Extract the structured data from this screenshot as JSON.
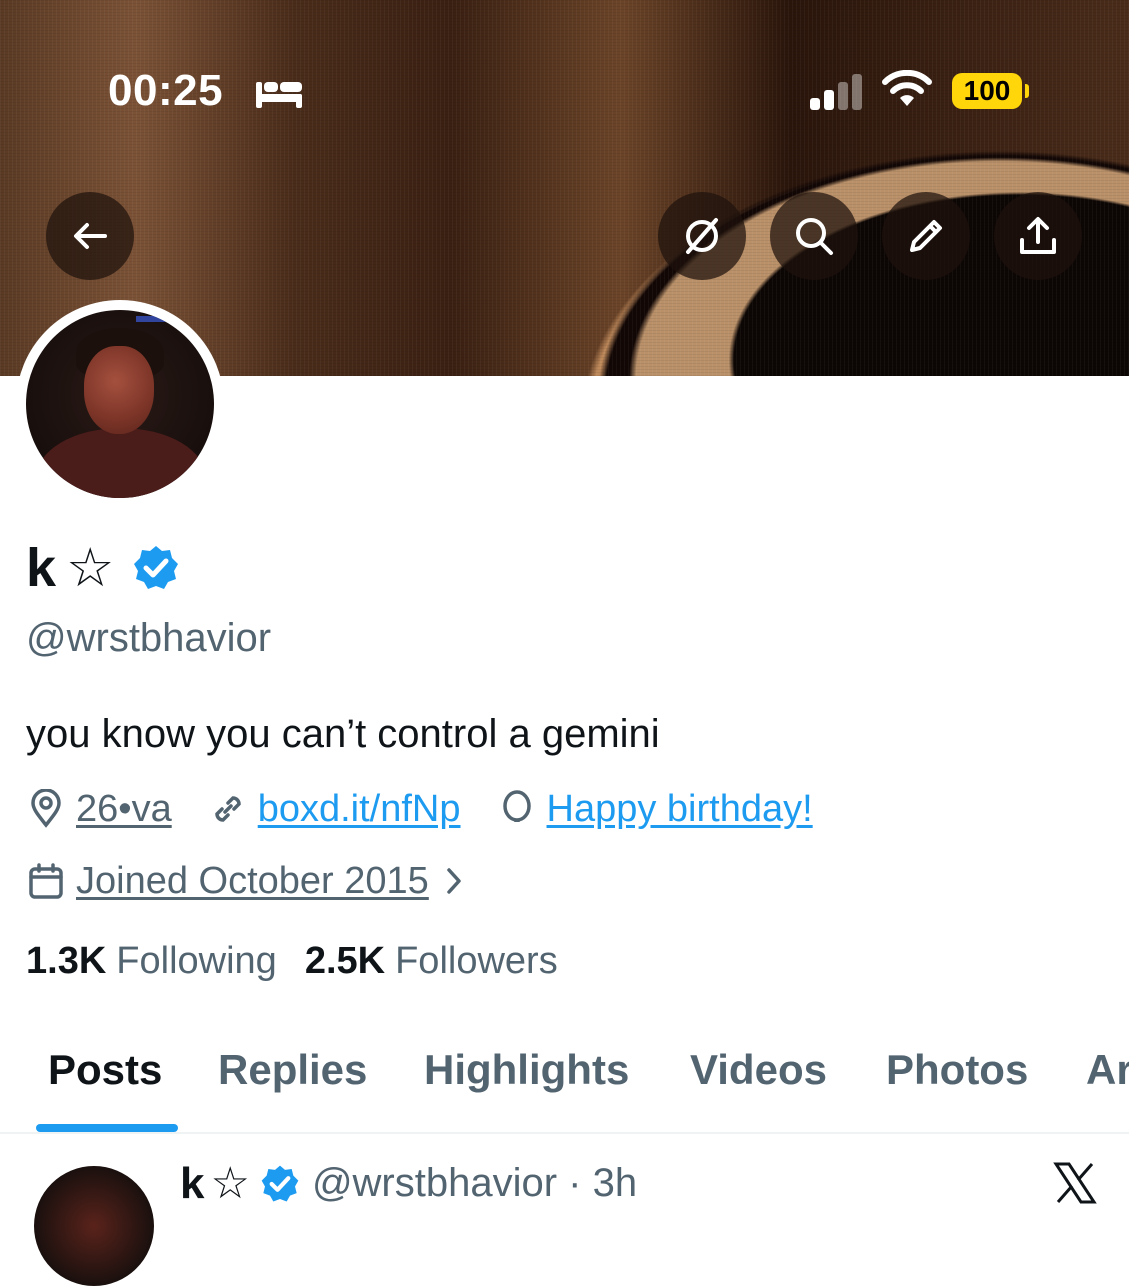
{
  "status_bar": {
    "time": "00:25",
    "battery": "100",
    "battery_color": "#ffd60a"
  },
  "header": {
    "back_icon": "arrow-left-icon",
    "actions": [
      "grok-icon",
      "search-icon",
      "edit-icon",
      "share-icon"
    ]
  },
  "profile": {
    "display_name": "k",
    "name_symbol": "☆",
    "verified": true,
    "handle": "@wrstbhavior",
    "bio": "you know you can’t control a gemini",
    "location": "26•va",
    "website": "boxd.it/nfNp",
    "birthday": "Happy birthday!",
    "joined": "Joined October 2015",
    "following_count": "1.3K",
    "following_label": "Following",
    "followers_count": "2.5K",
    "followers_label": "Followers"
  },
  "tabs": [
    {
      "label": "Posts",
      "active": true
    },
    {
      "label": "Replies",
      "active": false
    },
    {
      "label": "Highlights",
      "active": false
    },
    {
      "label": "Videos",
      "active": false
    },
    {
      "label": "Photos",
      "active": false
    },
    {
      "label": "Ar",
      "active": false
    }
  ],
  "post_preview": {
    "name": "k",
    "symbol": "☆",
    "handle_time": "@wrstbhavior · 3h"
  },
  "colors": {
    "accent": "#1d9bf0",
    "text_primary": "#0f1419",
    "text_secondary": "#536471"
  }
}
